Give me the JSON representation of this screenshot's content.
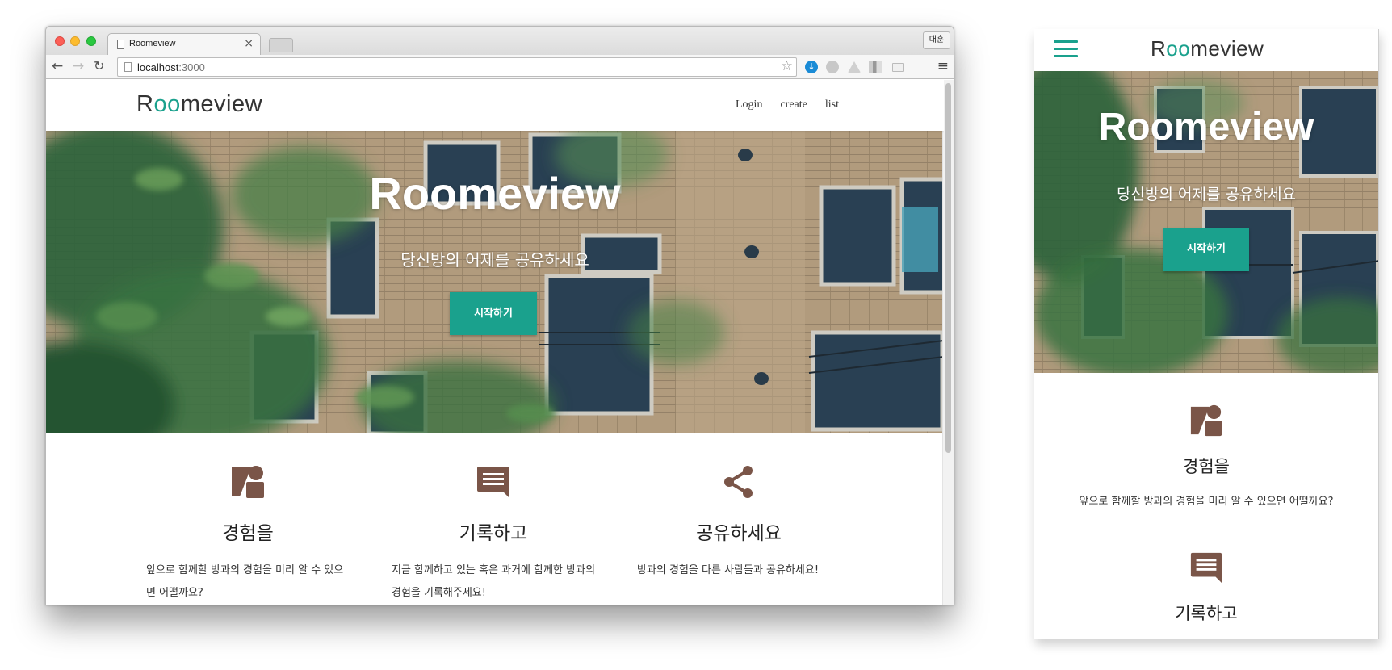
{
  "browser": {
    "tab_title": "Roomeview",
    "tab_close": "×",
    "profile_label": "대훈",
    "url_host": "localhost",
    "url_port": ":3000",
    "nav_back": "←",
    "nav_forward": "→",
    "nav_reload": "↻",
    "bookmark_star": "☆",
    "menu_glyph": "≡",
    "download_glyph": "↓"
  },
  "site": {
    "logo": {
      "first": "R",
      "accent": "oo",
      "rest": "meview"
    },
    "nav": [
      {
        "label": "Login"
      },
      {
        "label": "create"
      },
      {
        "label": "list"
      }
    ],
    "hero": {
      "title": "Roomeview",
      "subtitle": "당신방의 어제를 공유하세요",
      "cta": "시작하기"
    },
    "features": [
      {
        "icon": "experience-shapes-icon",
        "title": "경험을",
        "desc": "앞으로 함께할 방과의 경험을 미리 알 수 있으면 어떨까요?"
      },
      {
        "icon": "comment-icon",
        "title": "기록하고",
        "desc": "지금 함께하고 있는 혹은 과거에 함께한 방과의 경험을 기록해주세요!"
      },
      {
        "icon": "share-icon",
        "title": "공유하세요",
        "desc": "방과의 경험을 다른 사람들과 공유하세요!"
      }
    ]
  },
  "mobile": {
    "menu_icon": "hamburger-menu-icon",
    "features_visible": [
      {
        "icon": "experience-shapes-icon",
        "title": "경험을",
        "desc": "앞으로 함께할 방과의 경험을 미리 알 수 있으면 어떨까요?"
      },
      {
        "icon": "comment-icon",
        "title": "기록하고"
      }
    ]
  },
  "colors": {
    "accent": "#1aa18d",
    "icon_brown": "#7a5548",
    "text": "#333333"
  }
}
